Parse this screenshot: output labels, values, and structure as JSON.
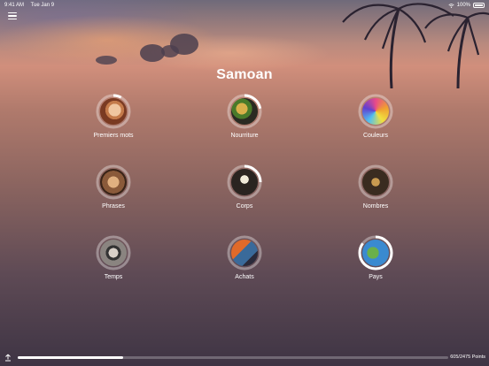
{
  "status_bar": {
    "time": "9:41 AM",
    "date": "Tue Jan 9",
    "battery": "100%"
  },
  "header": {
    "menu_icon": "hamburger-menu-icon",
    "title": "Samoan"
  },
  "categories": [
    {
      "label": "Premiers mots",
      "progress": 0.08,
      "art": "portrait"
    },
    {
      "label": "Nourriture",
      "progress": 0.22,
      "art": "food"
    },
    {
      "label": "Couleurs",
      "progress": 0.0,
      "art": "colors"
    },
    {
      "label": "Phrases",
      "progress": 0.0,
      "art": "phrases"
    },
    {
      "label": "Corps",
      "progress": 0.25,
      "art": "skeleton"
    },
    {
      "label": "Nombres",
      "progress": 0.0,
      "art": "numbers"
    },
    {
      "label": "Temps",
      "progress": 0.0,
      "art": "clock"
    },
    {
      "label": "Achats",
      "progress": 0.0,
      "art": "shopping"
    },
    {
      "label": "Pays",
      "progress": 0.85,
      "art": "map"
    }
  ],
  "footer": {
    "points_label": "605/2475 Points",
    "progress": 0.244,
    "icon": "upload-icon"
  }
}
